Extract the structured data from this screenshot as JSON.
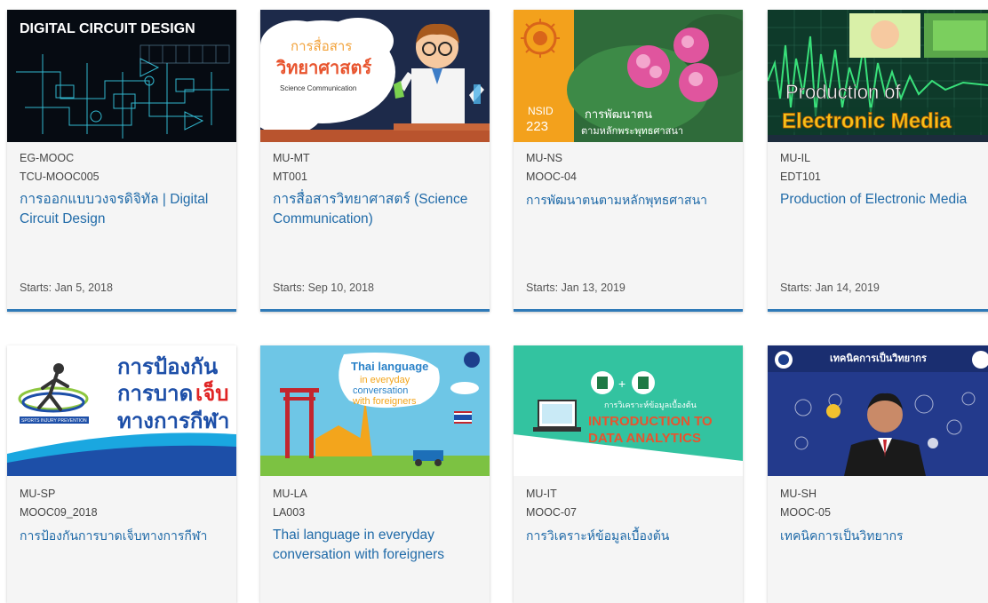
{
  "courses": [
    {
      "org": "EG-MOOC",
      "number": "TCU-MOOC005",
      "title": "การออกแบบวงจรดิจิทัล | Digital Circuit Design",
      "starts": "Starts: Jan 5, 2018",
      "image_text": [
        "DIGITAL CIRCUIT DESIGN"
      ],
      "image_colors": {
        "bg": "#060b12",
        "accent": "#3ad6f0"
      },
      "image_icon": "circuit-diagram-thumbnail"
    },
    {
      "org": "MU-MT",
      "number": "MT001",
      "title": "การสื่อสารวิทยาศาสตร์ (Science Communication)",
      "starts": "Starts: Sep 10, 2018",
      "image_text": [
        "การสื่อสาร",
        "วิทยาศาสตร์",
        "Science Communication"
      ],
      "image_colors": {
        "bg": "#1d2a4a",
        "accent": "#f2a23a"
      },
      "image_icon": "scientist-thumbnail"
    },
    {
      "org": "MU-NS",
      "number": "MOOC-04",
      "title": "การพัฒนาตนตามหลักพุทธศาสนา",
      "starts": "Starts: Jan 13, 2019",
      "image_text": [
        "NSID",
        "223",
        "การพัฒนาตน",
        "ตามหลักพระพุทธศาสนา"
      ],
      "image_colors": {
        "bg": "#2f6b3a",
        "accent": "#f3a11c"
      },
      "image_icon": "lotus-thumbnail"
    },
    {
      "org": "MU-IL",
      "number": "EDT101",
      "title": "Production of Electronic Media",
      "starts": "Starts: Jan 14, 2019",
      "image_text": [
        "Production of",
        "Electronic Media"
      ],
      "image_colors": {
        "bg": "#0e3a2a",
        "accent": "#f4c21a"
      },
      "image_icon": "waveform-thumbnail"
    },
    {
      "org": "MU-SP",
      "number": "MOOC09_2018",
      "title": "การป้องกันการบาดเจ็บทางการกีฬา",
      "image_text": [
        "การป้องกัน",
        "การบาด",
        "เจ็บ",
        "ทางการกีฬา",
        "SPORTS INJURY PREVENTION"
      ],
      "image_colors": {
        "bg": "#ffffff",
        "accent": "#1d4fa8"
      },
      "image_icon": "runner-thumbnail"
    },
    {
      "org": "MU-LA",
      "number": "LA003",
      "title": "Thai language in everyday conversation with foreigners",
      "image_text": [
        "Thai language",
        "in everyday",
        "conversation",
        "with foreigners"
      ],
      "image_colors": {
        "bg": "#6ec6e6",
        "accent": "#f3c400"
      },
      "image_icon": "thai-temple-thumbnail"
    },
    {
      "org": "MU-IT",
      "number": "MOOC-07",
      "title": "การวิเคราะห์ข้อมูลเบื้องต้น",
      "image_text": [
        "การวิเคราะห์ข้อมูลเบื้องต้น",
        "INTRODUCTION TO",
        "DATA ANALYTICS"
      ],
      "image_colors": {
        "bg": "#33c3a0",
        "accent": "#e8542e"
      },
      "image_icon": "laptop-analytics-thumbnail"
    },
    {
      "org": "MU-SH",
      "number": "MOOC-05",
      "title": "เทคนิคการเป็นวิทยากร",
      "image_text": [
        "เทคนิคการเป็นวิทยากร"
      ],
      "image_colors": {
        "bg": "#233a8c",
        "accent": "#f2c12e"
      },
      "image_icon": "speaker-thumbnail"
    }
  ]
}
